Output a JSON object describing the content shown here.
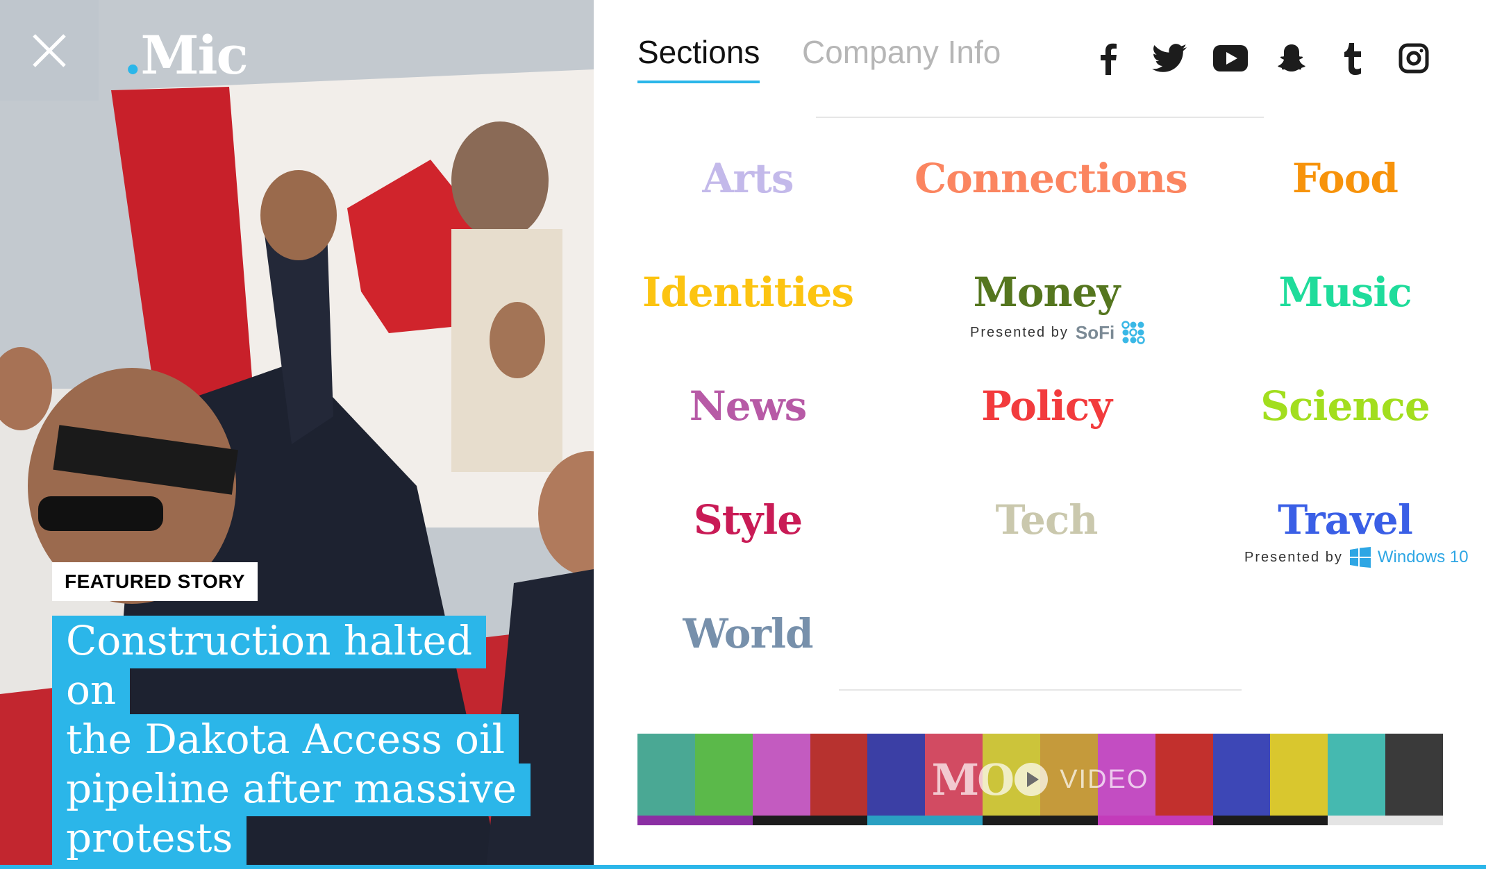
{
  "brand": {
    "logo_dot": ".",
    "logo_text": "Mic",
    "accent": "#2bb6e9"
  },
  "featured": {
    "badge": "FEATURED STORY",
    "headline_lines": [
      "Construction halted on",
      "the Dakota Access oil",
      "pipeline after massive",
      "protests"
    ]
  },
  "tabs": {
    "sections": "Sections",
    "company_info": "Company Info"
  },
  "social": [
    "facebook-icon",
    "twitter-icon",
    "youtube-icon",
    "snapchat-icon",
    "tumblr-icon",
    "instagram-icon"
  ],
  "sections": [
    {
      "label": "Arts",
      "color": "#c3b9ea"
    },
    {
      "label": "Connections",
      "color": "#fb8560"
    },
    {
      "label": "Food",
      "color": "#f7930b"
    },
    {
      "label": "Identities",
      "color": "#fcc411"
    },
    {
      "label": "Money",
      "color": "#55761f"
    },
    {
      "label": "Music",
      "color": "#1fdc9b"
    },
    {
      "label": "News",
      "color": "#b75aa6"
    },
    {
      "label": "Policy",
      "color": "#f23b3d"
    },
    {
      "label": "Science",
      "color": "#a2de1e"
    },
    {
      "label": "Style",
      "color": "#c91b56"
    },
    {
      "label": "Tech",
      "color": "#cac8ad"
    },
    {
      "label": "Travel",
      "color": "#3a5fe6"
    },
    {
      "label": "World",
      "color": "#7790ab"
    }
  ],
  "sponsors": {
    "money": {
      "presented_by": "Presented by",
      "sponsor": "SoFi"
    },
    "travel": {
      "presented_by": "Presented by",
      "sponsor": "Windows 10"
    }
  },
  "video": {
    "logo": "MO",
    "word": "VIDEO"
  }
}
